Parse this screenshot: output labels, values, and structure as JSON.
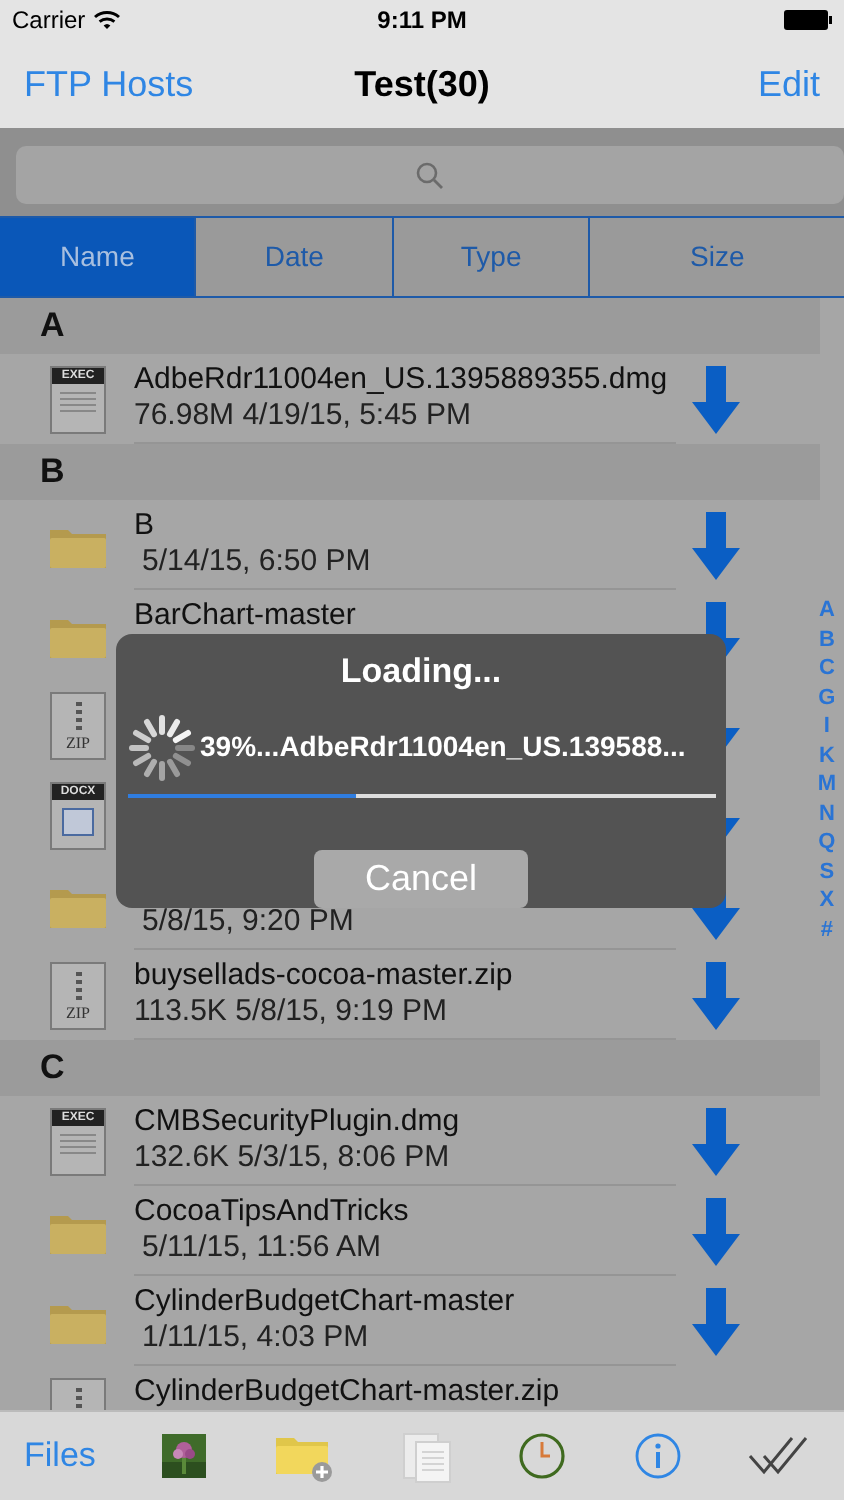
{
  "status_bar": {
    "carrier": "Carrier",
    "time": "9:11 PM"
  },
  "nav": {
    "back": "FTP Hosts",
    "title": "Test(30)",
    "edit": "Edit"
  },
  "sort_tabs": [
    {
      "label": "Name",
      "selected": true
    },
    {
      "label": "Date",
      "selected": false
    },
    {
      "label": "Type",
      "selected": false
    },
    {
      "label": "Size",
      "selected": false
    }
  ],
  "sections": [
    {
      "letter": "A",
      "items": [
        {
          "kind": "exec",
          "icon_label": "EXEC",
          "name": "AdbeRdr11004en_US.1395889355.dmg",
          "details": "76.98M 4/19/15, 5:45 PM"
        }
      ]
    },
    {
      "letter": "B",
      "items": [
        {
          "kind": "folder",
          "name": "B",
          "details": "5/14/15, 6:50 PM"
        },
        {
          "kind": "folder",
          "name": "BarChart-master"
        },
        {
          "kind": "zip",
          "icon_label": "ZIP"
        },
        {
          "kind": "docx",
          "icon_label": "DOCX"
        },
        {
          "kind": "folder",
          "details": "5/8/15, 9:20 PM"
        },
        {
          "kind": "zip",
          "icon_label": "ZIP",
          "name": "buysellads-cocoa-master.zip",
          "details": "113.5K 5/8/15, 9:19 PM"
        }
      ]
    },
    {
      "letter": "C",
      "items": [
        {
          "kind": "exec",
          "icon_label": "EXEC",
          "name": "CMBSecurityPlugin.dmg",
          "details": "132.6K 5/3/15, 8:06 PM"
        },
        {
          "kind": "folder",
          "name": "CocoaTipsAndTricks",
          "details": "5/11/15, 11:56 AM"
        },
        {
          "kind": "folder",
          "name": "CylinderBudgetChart-master",
          "details": "1/11/15, 4:03 PM"
        },
        {
          "kind": "zip",
          "name": "CylinderBudgetChart-master.zip"
        }
      ]
    }
  ],
  "index": [
    "A",
    "B",
    "C",
    "G",
    "I",
    "K",
    "M",
    "N",
    "Q",
    "S",
    "X",
    "#"
  ],
  "hud": {
    "title": "Loading...",
    "message": "39%...AdbeRdr11004en_US.139588...",
    "level": 0.39,
    "cancel": "Cancel"
  },
  "toolbar": {
    "files": "Files"
  }
}
